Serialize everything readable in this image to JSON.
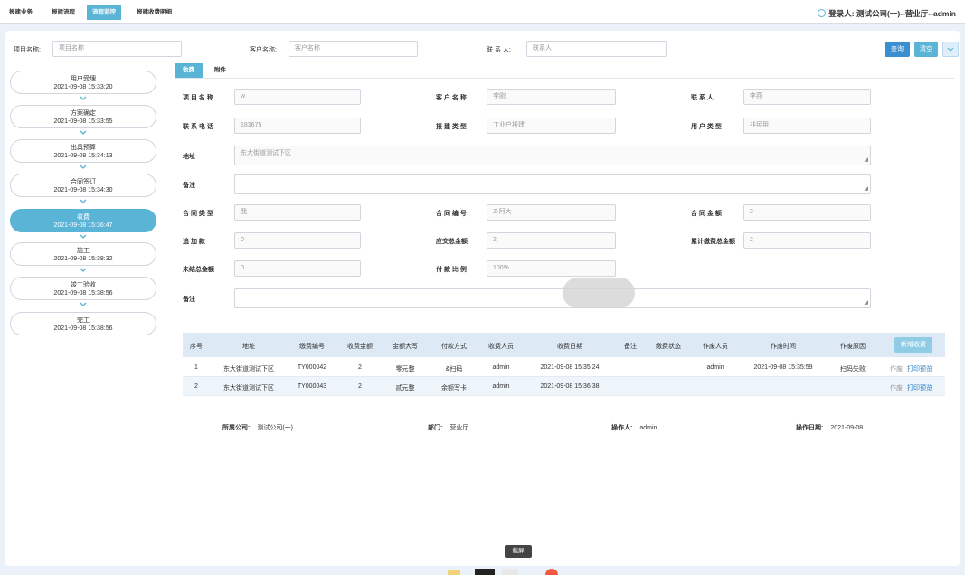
{
  "top_tabs": [
    {
      "label": "报建业务"
    },
    {
      "label": "报建流程"
    },
    {
      "label": "流程监控"
    },
    {
      "label": "报建收费明细"
    }
  ],
  "login": {
    "label": "登录人:",
    "value": "测试公司(一)--营业厅--admin"
  },
  "search": {
    "project_label": "项目名称:",
    "project_placeholder": "项目名称",
    "customer_label": "客户名称:",
    "customer_placeholder": "客户名称",
    "contact_label": "联 系 人:",
    "contact_placeholder": "联系人",
    "query_label": "查询",
    "clear_label": "清空"
  },
  "steps": [
    {
      "name": "用户受理",
      "time": "2021-09-08 15:33:20"
    },
    {
      "name": "方案确定",
      "time": "2021-09-08 15:33:55"
    },
    {
      "name": "出具预算",
      "time": "2021-09-08 15:34:13"
    },
    {
      "name": "合同签订",
      "time": "2021-09-08 15:34:30"
    },
    {
      "name": "收费",
      "time": "2021-09-08 15:36:47"
    },
    {
      "name": "施工",
      "time": "2021-09-08 15:38:32"
    },
    {
      "name": "竣工验收",
      "time": "2021-09-08 15:38:56"
    },
    {
      "name": "完工",
      "time": "2021-09-08 15:38:56"
    }
  ],
  "sub_tabs": [
    {
      "label": "收费"
    },
    {
      "label": "附件"
    }
  ],
  "form": {
    "project_name": {
      "label": "项 目 名 称",
      "value": "w"
    },
    "customer_name": {
      "label": "客 户 名 称",
      "value": "李刚"
    },
    "contact": {
      "label": "联 系 人",
      "value": "李燕"
    },
    "phone": {
      "label": "联 系 电 话",
      "value": "183675"
    },
    "report_type": {
      "label": "报 建 类 型",
      "value": "工业户报建"
    },
    "user_type": {
      "label": "用 户 类 型",
      "value": "非民用"
    },
    "address": {
      "label": "地址",
      "value": "东大街道测试下区"
    },
    "remark": {
      "label": "备注",
      "value": ""
    },
    "contract_type": {
      "label": "合 同 类 型",
      "value": "我"
    },
    "contract_no": {
      "label": "合 同 编 号",
      "value": "Z-阿大"
    },
    "contract_amount": {
      "label": "合 同 金 额",
      "value": "2"
    },
    "additional": {
      "label": "追 加 款",
      "value": "0"
    },
    "total_due": {
      "label": "应交总金额",
      "value": "2"
    },
    "total_paid": {
      "label": "累计缴费总金额",
      "value": "2"
    },
    "unpaid": {
      "label": "未结总金额",
      "value": "0"
    },
    "pay_ratio": {
      "label": "付 款 比 例",
      "value": "100%"
    },
    "remark2": {
      "label": "备注",
      "value": ""
    }
  },
  "table": {
    "headers": [
      "序号",
      "地址",
      "缴费编号",
      "收费金额",
      "金额大写",
      "付款方式",
      "收费人员",
      "收费日期",
      "备注",
      "缴费状态",
      "作废人员",
      "作废时间",
      "作废原因"
    ],
    "add_label": "新增收费",
    "rows": [
      {
        "cells": [
          "1",
          "东大街道测试下区",
          "TY000042",
          "2",
          "零元整",
          "&扫码",
          "admin",
          "2021-09-08 15:35:24",
          "",
          "",
          "admin",
          "2021-09-08 15:35:59",
          "扫码失败"
        ],
        "void": "作废",
        "print": "打印预览"
      },
      {
        "cells": [
          "2",
          "东大街道测试下区",
          "TY000043",
          "2",
          "贰元整",
          "余额写卡",
          "admin",
          "2021-09-08 15:36:38",
          "",
          "",
          "",
          "",
          ""
        ],
        "void": "作废",
        "print": "打印预览"
      }
    ]
  },
  "footer": {
    "company_label": "所属公司:",
    "company": "测试公司(一)",
    "dept_label": "部门:",
    "dept": "营业厅",
    "operator_label": "操作人:",
    "operator": "admin",
    "date_label": "操作日期:",
    "date": "2021-09-08"
  },
  "screenshot_tooltip": "截屏",
  "colors": {
    "accent": "#5ab4d6",
    "query": "#3a8fd0",
    "link": "#2d7fc4"
  }
}
